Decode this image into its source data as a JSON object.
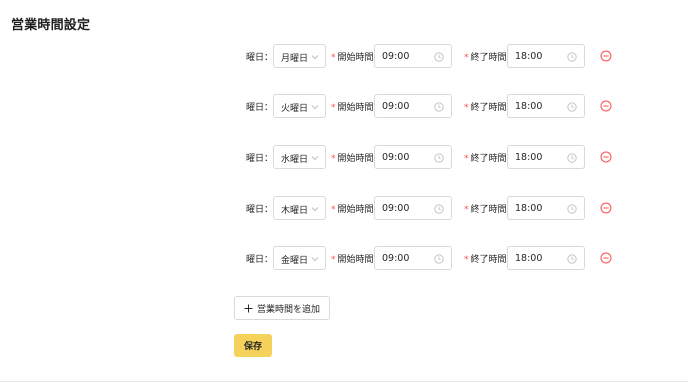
{
  "page": {
    "title": "営業時間設定"
  },
  "schedule": {
    "day_label": "曜日：",
    "start_label": "開始時間",
    "end_label": "終了時間",
    "required_mark": "*",
    "rows": [
      {
        "day": "月曜日",
        "start": "09:00",
        "end": "18:00"
      },
      {
        "day": "火曜日",
        "start": "09:00",
        "end": "18:00"
      },
      {
        "day": "水曜日",
        "start": "09:00",
        "end": "18:00"
      },
      {
        "day": "木曜日",
        "start": "09:00",
        "end": "18:00"
      },
      {
        "day": "金曜日",
        "start": "09:00",
        "end": "18:00"
      }
    ]
  },
  "actions": {
    "add_label": "営業時間を追加",
    "save_label": "保存"
  },
  "colors": {
    "accent": "#f5d35b",
    "danger": "#ff4d4f",
    "border": "#d9d9d9"
  },
  "icons": {
    "select_arrow": "chevron-down-icon",
    "time": "clock-icon",
    "remove": "minus-circle-icon",
    "add": "plus-icon"
  }
}
